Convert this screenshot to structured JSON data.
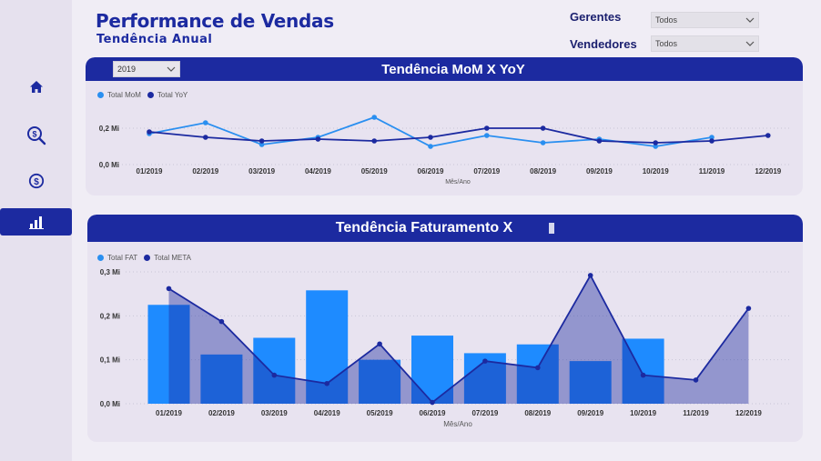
{
  "header": {
    "title": "Performance de Vendas",
    "subtitle": "Tendência Anual"
  },
  "filters": {
    "gerentes_label": "Gerentes",
    "gerentes_value": "Todos",
    "vendedores_label": "Vendedores",
    "vendedores_value": "Todos"
  },
  "sidebar": {
    "items": [
      {
        "icon": "home-icon"
      },
      {
        "icon": "search-money-icon"
      },
      {
        "icon": "dollar-icon"
      },
      {
        "icon": "bar-chart-icon",
        "active": true
      }
    ]
  },
  "colors": {
    "brand": "#1c2aa0",
    "light_series": "#2a8ff0",
    "dark_series": "#1c2aa0",
    "area_fill": "#8c8fd0"
  },
  "year_filter": "2019",
  "chart1": {
    "header": "Tendência MoM X YoY",
    "legend": [
      "Total MoM",
      "Total YoY"
    ]
  },
  "chart2": {
    "header": "Tendência Faturamento X",
    "legend": [
      "Total FAT",
      "Total META"
    ]
  },
  "chart_data": [
    {
      "type": "line",
      "title": "Tendência MoM X YoY",
      "xlabel": "Mês/Ano",
      "ylabel": "",
      "categories": [
        "01/2019",
        "02/2019",
        "03/2019",
        "04/2019",
        "05/2019",
        "06/2019",
        "07/2019",
        "08/2019",
        "09/2019",
        "10/2019",
        "11/2019",
        "12/2019"
      ],
      "yticks": [
        "0,0 Mi",
        "0,2 Mi"
      ],
      "ylim": [
        0,
        0.3
      ],
      "series": [
        {
          "name": "Total MoM",
          "values": [
            0.17,
            0.23,
            0.11,
            0.15,
            0.26,
            0.1,
            0.16,
            0.12,
            0.14,
            0.1,
            0.15,
            null
          ]
        },
        {
          "name": "Total YoY",
          "values": [
            0.18,
            0.15,
            0.13,
            0.14,
            0.13,
            0.15,
            0.2,
            0.2,
            0.13,
            0.12,
            0.13,
            0.16
          ]
        }
      ],
      "legend_position": "top-left"
    },
    {
      "type": "bar",
      "title": "Tendência Faturamento X",
      "xlabel": "Mês/Ano",
      "ylabel": "",
      "categories": [
        "01/2019",
        "02/2019",
        "03/2019",
        "04/2019",
        "05/2019",
        "06/2019",
        "07/2019",
        "08/2019",
        "09/2019",
        "10/2019",
        "11/2019",
        "12/2019"
      ],
      "yticks": [
        "0,0 Mi",
        "0,1 Mi",
        "0,2 Mi",
        "0,3 Mi"
      ],
      "ylim": [
        0,
        0.3
      ],
      "series": [
        {
          "name": "Total FAT",
          "type": "bar",
          "values": [
            0.225,
            0.112,
            0.15,
            0.258,
            0.1,
            0.155,
            0.115,
            0.135,
            0.097,
            0.148,
            0,
            0
          ]
        },
        {
          "name": "Total META",
          "type": "area",
          "values": [
            0.262,
            0.187,
            0.065,
            0.046,
            0.136,
            0.003,
            0.097,
            0.082,
            0.292,
            0.065,
            0.054,
            0.217
          ]
        }
      ],
      "legend_position": "top-left"
    }
  ]
}
